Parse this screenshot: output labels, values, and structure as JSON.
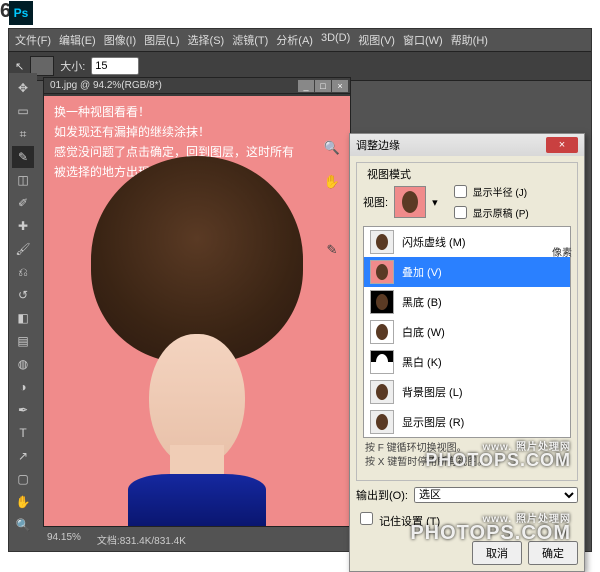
{
  "step_number": "6.",
  "menubar": [
    "文件(F)",
    "编辑(E)",
    "图像(I)",
    "图层(L)",
    "选择(S)",
    "滤镜(T)",
    "分析(A)",
    "3D(D)",
    "视图(V)",
    "窗口(W)",
    "帮助(H)"
  ],
  "optbar": {
    "size_label": "大小:",
    "size_value": "15"
  },
  "doc_tab": "01.jpg @ 94.2%(RGB/8*)",
  "canvas_text": [
    "换一种视图看看！",
    "如发现还有漏掉的继续涂抹！",
    "感觉没问题了点击确定，回到图层，这时所有",
    "被选择的地方出现选区（斑马线）"
  ],
  "status": {
    "zoom": "94.15%",
    "docinfo": "文档:831.4K/831.4K"
  },
  "dialog": {
    "title": "调整边缘",
    "fieldset_label": "视图模式",
    "view_label": "视图:",
    "chk_radius": "显示半径 (J)",
    "chk_original": "显示原稿 (P)",
    "unit": "像素",
    "items": [
      {
        "label": "闪烁虚线 (M)",
        "cls": ""
      },
      {
        "label": "叠加 (V)",
        "cls": "pink",
        "selected": true
      },
      {
        "label": "黑底 (B)",
        "cls": "black"
      },
      {
        "label": "白底 (W)",
        "cls": "white"
      },
      {
        "label": "黑白 (K)",
        "cls": "bw"
      },
      {
        "label": "背景图层 (L)",
        "cls": ""
      },
      {
        "label": "显示图层 (R)",
        "cls": ""
      }
    ],
    "hint1": "按 F 键循环切换视图。",
    "hint2": "按 X 键暂时停用所有视图。",
    "output_label": "输出到(O):",
    "output_value": "选区",
    "remember": "记住设置 (T)",
    "cancel": "取消",
    "ok": "确定"
  },
  "watermark": {
    "small": "www.  照片处理网",
    "big": "PHOTOPS.COM"
  }
}
